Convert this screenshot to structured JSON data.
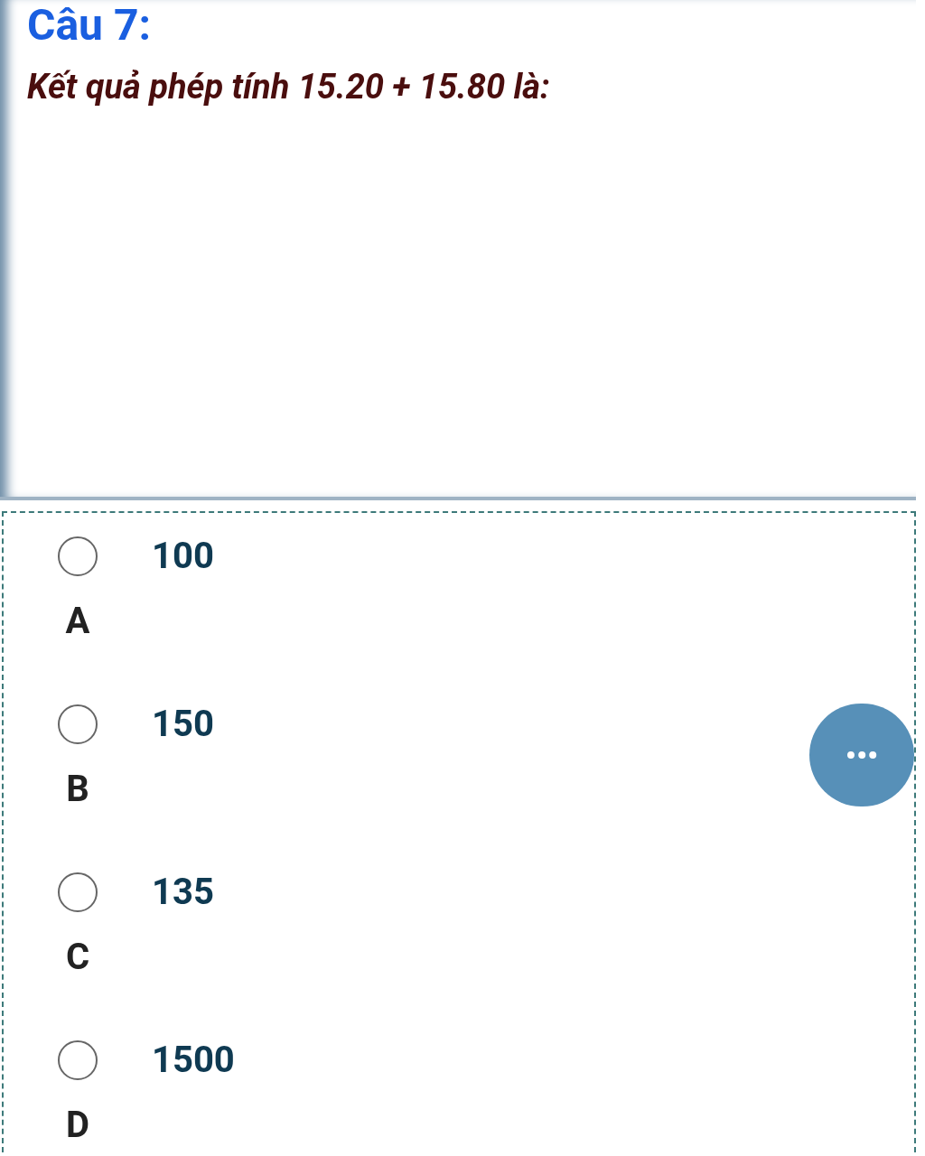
{
  "question": {
    "title": "Câu 7:",
    "text": "Kết quả phép tính 15.20 + 15.80 là:"
  },
  "options": [
    {
      "value": "100",
      "letter": "A",
      "selected": false
    },
    {
      "value": "150",
      "letter": "B",
      "selected": false
    },
    {
      "value": "135",
      "letter": "C",
      "selected": false
    },
    {
      "value": "1500",
      "letter": "D",
      "selected": false
    }
  ],
  "more_button": {
    "label": "•••"
  }
}
